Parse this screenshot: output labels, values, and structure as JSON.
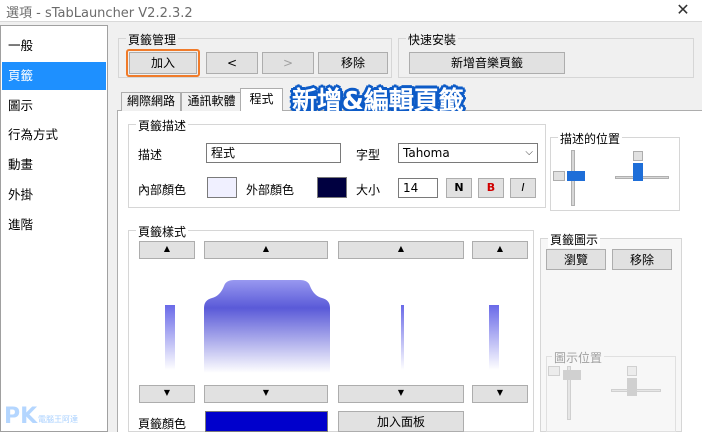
{
  "window": {
    "title": "選項 - sTabLauncher V2.2.3.2",
    "close_glyph": "✕"
  },
  "sidebar": {
    "items": [
      {
        "label": "一般",
        "selected": false
      },
      {
        "label": "頁籤",
        "selected": true
      },
      {
        "label": "圖示",
        "selected": false
      },
      {
        "label": "行為方式",
        "selected": false
      },
      {
        "label": "動畫",
        "selected": false
      },
      {
        "label": "外掛",
        "selected": false
      },
      {
        "label": "進階",
        "selected": false
      }
    ]
  },
  "tab_mgmt": {
    "label": "頁籤管理",
    "add": "加入",
    "prev": "<",
    "next": ">",
    "remove": "移除"
  },
  "quick_install": {
    "label": "快速安裝",
    "add_music": "新增音樂頁籤"
  },
  "tabs": [
    {
      "label": "網際網路",
      "selected": false
    },
    {
      "label": "通訊軟體",
      "selected": false
    },
    {
      "label": "程式",
      "selected": true
    }
  ],
  "annotation": "新增&編輯頁籤",
  "desc": {
    "label": "頁籤描述",
    "desc_label": "描述",
    "desc_value": "程式",
    "font_label": "字型",
    "font_value": "Tahoma",
    "inner_color_label": "內部顏色",
    "outer_color_label": "外部顏色",
    "size_label": "大小",
    "size_value": "14",
    "bold": "N",
    "bold_red": "B",
    "italic": "I",
    "inner_color": "#f0f0ff",
    "outer_color": "#000040"
  },
  "position": {
    "label": "描述的位置"
  },
  "style": {
    "label": "頁籤樣式",
    "color_label": "頁籤顏色",
    "color": "#0000cc",
    "add_panel": "加入面板",
    "arrow": "▲",
    "arrow_down": "▼"
  },
  "icon": {
    "label": "頁籤圖示",
    "browse": "瀏覽",
    "remove": "移除",
    "position_label": "圖示位置"
  },
  "watermark": {
    "main": "PK",
    "sub": "電腦王阿達"
  },
  "colors": {
    "accent": "#1e90ff",
    "highlight": "#f07b2a",
    "annotation_stroke": "#0d5bc7"
  }
}
